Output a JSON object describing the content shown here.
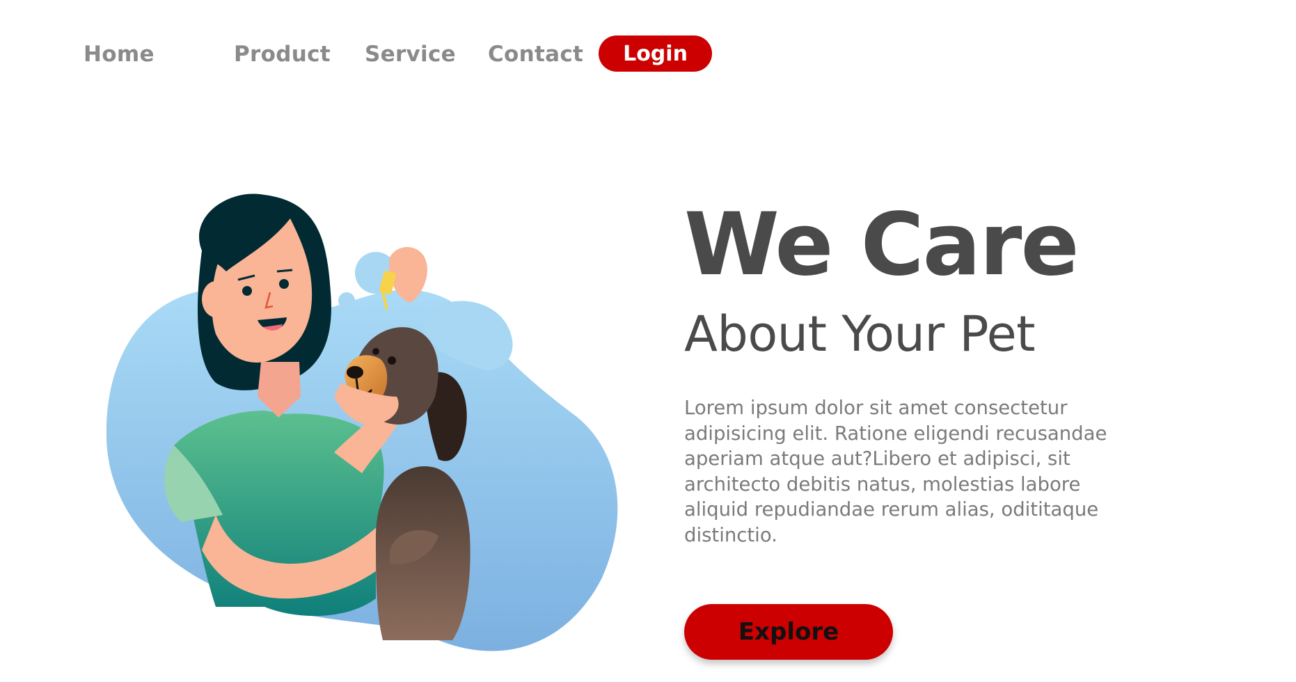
{
  "nav": {
    "home_label": "Home",
    "product_label": "Product",
    "service_label": "Service",
    "contact_label": "Contact",
    "login_label": "Login"
  },
  "hero": {
    "title": "We Care",
    "subtitle": "About Your Pet",
    "body": "Lorem ipsum dolor sit amet consectetur adipisicing elit. Ratione eligendi recusandae aperiam atque aut?Libero et adipisci, sit architecto debitis natus, molestias labore aliquid repudiandae rerum alias, odititaque distinctio.",
    "cta_label": "Explore"
  },
  "illustration": {
    "subject": "woman-giving-ear-drops-to-dog"
  },
  "colors": {
    "accent": "#cc0000",
    "heading": "#4a4a4a",
    "nav_text": "#8a8a8a",
    "body_text": "#7a7a7a",
    "blob_blue": "#8ec3ea",
    "shirt_green": "#3fa783"
  }
}
